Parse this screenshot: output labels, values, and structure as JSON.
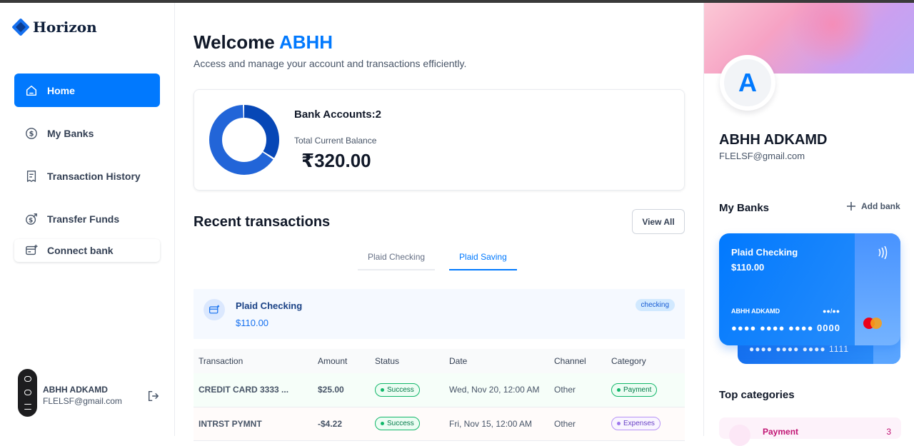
{
  "app": {
    "name": "Horizon",
    "brand_color": "#0179fe"
  },
  "sidebar": {
    "items": [
      {
        "label": "Home",
        "icon": "home-icon",
        "active": true
      },
      {
        "label": "My Banks",
        "icon": "dollar-circle-icon",
        "active": false
      },
      {
        "label": "Transaction History",
        "icon": "receipt-icon",
        "active": false
      },
      {
        "label": "Transfer Funds",
        "icon": "money-send-icon",
        "active": false
      }
    ],
    "connect_bank": "Connect bank",
    "user": {
      "name": "ABHH ADKAMD",
      "email": "FLELSF@gmail.com"
    }
  },
  "header": {
    "welcome_prefix": "Welcome",
    "welcome_name": "ABHH",
    "subtitle": "Access and manage your account and transactions efficiently."
  },
  "balance": {
    "bank_accounts_label": "Bank Accounts:",
    "bank_accounts_count": "2",
    "total_label": "Total Current Balance",
    "total_value": "₹320.00",
    "donut_segments": [
      {
        "name": "Plaid Checking",
        "share": 0.344,
        "color": "#0747b6"
      },
      {
        "name": "Plaid Saving",
        "share": 0.656,
        "color": "#2265d8"
      }
    ]
  },
  "recent": {
    "title": "Recent transactions",
    "view_all": "View All",
    "tabs": [
      {
        "label": "Plaid Checking",
        "active": false
      },
      {
        "label": "Plaid Saving",
        "active": true
      }
    ],
    "bank_info": {
      "name": "Plaid Checking",
      "amount": "$110.00",
      "type": "checking"
    },
    "columns": [
      "Transaction",
      "Amount",
      "Status",
      "Date",
      "Channel",
      "Category"
    ],
    "rows": [
      {
        "name": "CREDIT CARD 3333 ...",
        "amount": "$25.00",
        "status": "Success",
        "date": "Wed, Nov 20, 12:00 AM",
        "channel": "Other",
        "category": "Payment"
      },
      {
        "name": "INTRST PYMNT",
        "amount": "-$4.22",
        "status": "Success",
        "date": "Fri, Nov 15, 12:00 AM",
        "channel": "Other",
        "category": "Expenses"
      }
    ]
  },
  "profile": {
    "initial": "A",
    "name": "ABHH ADKAMD",
    "email": "FLELSF@gmail.com",
    "my_banks_title": "My Banks",
    "add_bank": "Add bank",
    "card": {
      "name": "Plaid Checking",
      "amount": "$110.00",
      "holder": "ABHH ADKAMD",
      "expiry": "●●/●●",
      "number": "●●●● ●●●● ●●●● 0000",
      "back_number": "●●●● ●●●● ●●●● 1111"
    },
    "top_categories_title": "Top categories",
    "top_categories": [
      {
        "name": "Payment",
        "count": "3"
      }
    ]
  }
}
